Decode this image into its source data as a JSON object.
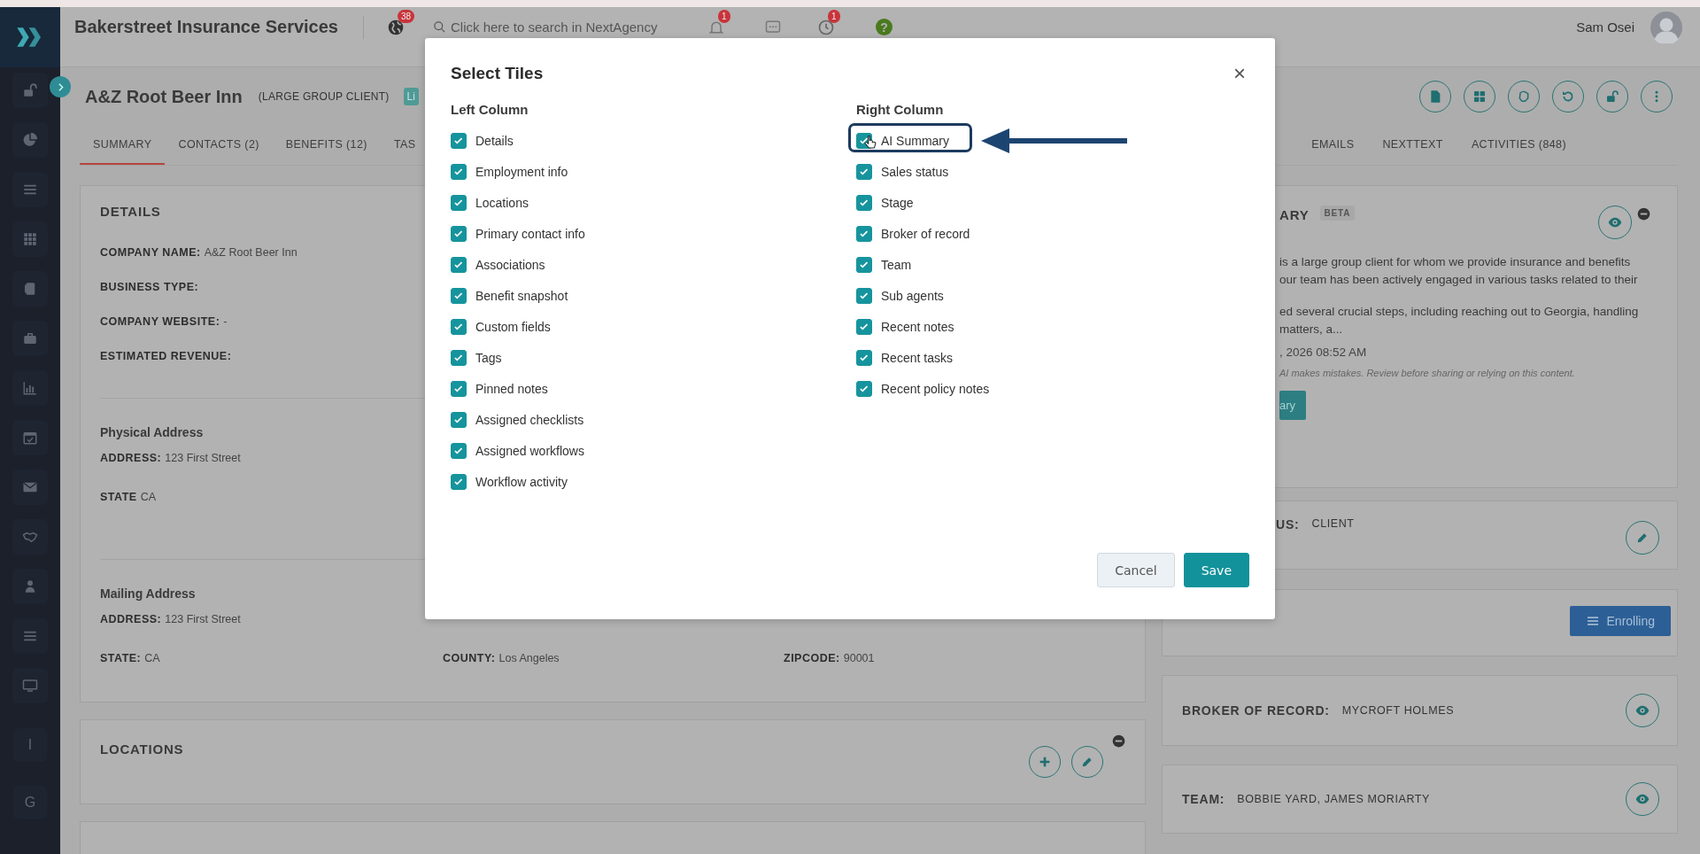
{
  "top_bar": {
    "brand": "Bakerstreet Insurance Services",
    "globe_badge": "38",
    "search": {
      "placeholder": "Click here to search in NextAgency"
    },
    "bell_badge": "1",
    "clock_badge": "1",
    "help": "?",
    "user_name": "Sam Osei"
  },
  "sidebar": {
    "letters": [
      "I",
      "G"
    ]
  },
  "record": {
    "name": "A&Z Root Beer Inn",
    "type": "(LARGE GROUP CLIENT)",
    "badge": "Li"
  },
  "tabs": {
    "left": [
      {
        "label": "SUMMARY",
        "selected": true
      },
      {
        "label": "CONTACTS (2)",
        "selected": false
      },
      {
        "label": "BENEFITS (12)",
        "selected": false
      },
      {
        "label": "TAS",
        "selected": false
      }
    ],
    "right": [
      {
        "label": "EMAILS",
        "selected": false
      },
      {
        "label": "NEXTTEXT",
        "selected": false
      },
      {
        "label": "ACTIVITIES (848)",
        "selected": false
      }
    ]
  },
  "details": {
    "title": "DETAILS",
    "fields": [
      {
        "label": "COMPANY NAME:",
        "value": "A&Z Root Beer Inn"
      },
      {
        "label": "BUSINESS TYPE:"
      },
      {
        "label": "COMPANY WEBSITE:",
        "value": "-"
      },
      {
        "label": "ESTIMATED REVENUE:"
      }
    ],
    "addresses": [
      {
        "title": "Physical Address",
        "rows": [
          [
            {
              "label": "ADDRESS:",
              "value": "123 First Street"
            }
          ],
          [
            {
              "label": "STATE",
              "value": "CA"
            }
          ]
        ]
      },
      {
        "title": "Mailing Address",
        "rows": [
          [
            {
              "label": "ADDRESS:",
              "value": "123 First Street"
            }
          ],
          [
            {
              "label": "STATE:",
              "value": "CA"
            },
            {
              "label": "COUNTY:",
              "value": "Los Angeles"
            },
            {
              "label": "ZIPCODE:",
              "value": "90001"
            }
          ]
        ]
      }
    ]
  },
  "locations": {
    "title": "LOCATIONS"
  },
  "right_cards": [
    {
      "kind": "ai_summary",
      "title": "ARY",
      "badge": "BETA",
      "paragraphs": [
        [
          "is a large group client for whom we provide insurance and benefits",
          "our team has been actively engaged in various tasks related to their"
        ],
        [
          "ed several crucial steps, including reaching out to Georgia, handling",
          "matters, a..."
        ]
      ],
      "date": ", 2026 08:52 AM",
      "disclaimer": "AI makes mistakes. Review before sharing or relying on this content.",
      "button": "ary"
    },
    {
      "kind": "editable",
      "label": "US:",
      "value": "CLIENT"
    },
    {
      "kind": "stage",
      "button": "Enrolling"
    },
    {
      "kind": "viewable",
      "label": "BROKER OF RECORD:",
      "value": "MYCROFT HOLMES"
    },
    {
      "kind": "viewable",
      "label": "TEAM:",
      "value": "BOBBIE YARD, JAMES MORIARTY"
    }
  ],
  "modal": {
    "title": "Select Tiles",
    "close": "×",
    "columns": [
      {
        "heading": "Left Column",
        "items": [
          {
            "label": "Details",
            "checked": true,
            "highlighted": false
          },
          {
            "label": "Employment info",
            "checked": true,
            "highlighted": false
          },
          {
            "label": "Locations",
            "checked": true,
            "highlighted": false
          },
          {
            "label": "Primary contact info",
            "checked": true,
            "highlighted": false
          },
          {
            "label": "Associations",
            "checked": true,
            "highlighted": false
          },
          {
            "label": "Benefit snapshot",
            "checked": true,
            "highlighted": false
          },
          {
            "label": "Custom fields",
            "checked": true,
            "highlighted": false
          },
          {
            "label": "Tags",
            "checked": true,
            "highlighted": false
          },
          {
            "label": "Pinned notes",
            "checked": true,
            "highlighted": false
          },
          {
            "label": "Assigned checklists",
            "checked": true,
            "highlighted": false
          },
          {
            "label": "Assigned workflows",
            "checked": true,
            "highlighted": false
          },
          {
            "label": "Workflow activity",
            "checked": true,
            "highlighted": false
          }
        ]
      },
      {
        "heading": "Right Column",
        "items": [
          {
            "label": "AI Summary",
            "checked": true,
            "highlighted": true
          },
          {
            "label": "Sales status",
            "checked": true,
            "highlighted": false
          },
          {
            "label": "Stage",
            "checked": true,
            "highlighted": false
          },
          {
            "label": "Broker of record",
            "checked": true,
            "highlighted": false
          },
          {
            "label": "Team",
            "checked": true,
            "highlighted": false
          },
          {
            "label": "Sub agents",
            "checked": true,
            "highlighted": false
          },
          {
            "label": "Recent notes",
            "checked": true,
            "highlighted": false
          },
          {
            "label": "Recent tasks",
            "checked": true,
            "highlighted": false
          },
          {
            "label": "Recent policy notes",
            "checked": true,
            "highlighted": false
          }
        ]
      }
    ],
    "buttons": [
      {
        "label": "Cancel",
        "kind": "secondary"
      },
      {
        "label": "Save",
        "kind": "primary"
      }
    ]
  }
}
